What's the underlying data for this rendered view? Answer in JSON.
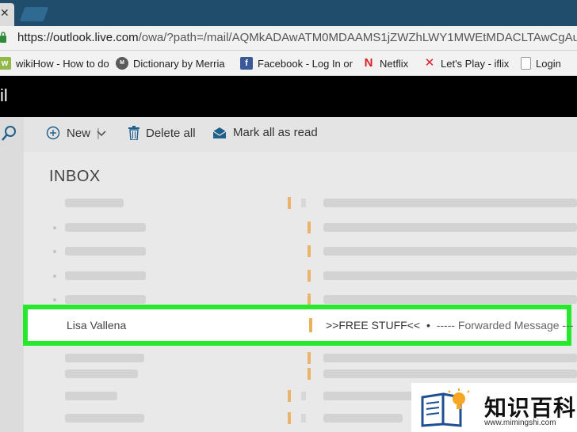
{
  "browser": {
    "url_host": "https://outlook.live.com",
    "url_path": "/owa/?path=/mail/AQMkADAwATM0MDAAMS1jZWZhLWY1MWEtMDACLTAwCgAuAAA",
    "bookmarks": [
      {
        "label": "wikiHow - How to do",
        "icon": "wikihow-icon"
      },
      {
        "label": "Dictionary by Merria",
        "icon": "merriam-icon"
      },
      {
        "label": "Facebook - Log In or",
        "icon": "facebook-icon"
      },
      {
        "label": "Netflix",
        "icon": "netflix-icon"
      },
      {
        "label": "Let's Play - iflix",
        "icon": "iflix-icon"
      },
      {
        "label": "Login",
        "icon": "page-icon"
      }
    ]
  },
  "app": {
    "name": "il"
  },
  "toolbar": {
    "new_label": "New",
    "delete_all_label": "Delete all",
    "mark_all_read_label": "Mark all as read"
  },
  "inbox": {
    "title": "INBOX",
    "highlighted": {
      "sender": "Lisa Vallena",
      "subject": ">>FREE STUFF<<",
      "separator": "•",
      "preview": "----- Forwarded Message ---"
    }
  },
  "watermark": {
    "title": "知识百科",
    "url": "www.mimingshi.com"
  },
  "colors": {
    "highlight": "#26e82c",
    "flag": "#eab56a",
    "appbar": "#000000",
    "accent": "#1f5f8b"
  }
}
